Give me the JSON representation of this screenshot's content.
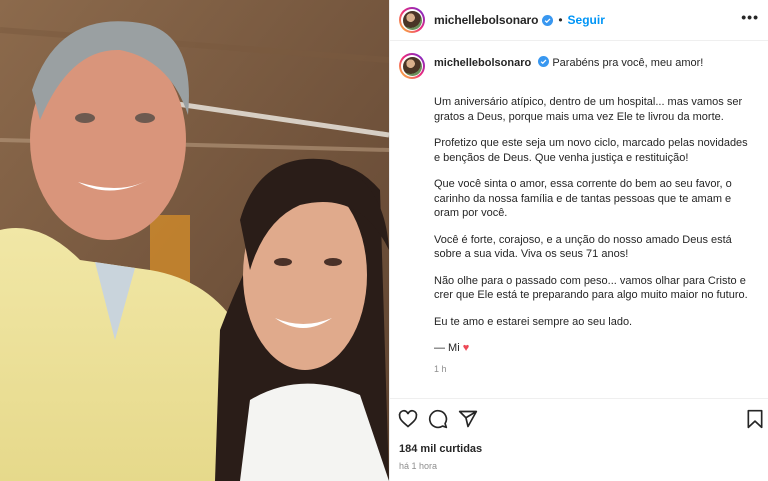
{
  "post": {
    "username": "michellebolsonaro",
    "follow_label": "Seguir",
    "separator": "•",
    "more_label": "•••",
    "caption_first": "Parabéns pra você, meu amor!",
    "paragraphs": [
      "Um aniversário atípico, dentro de um hospital... mas vamos ser gratos a Deus, porque mais uma vez Ele te livrou da morte.",
      "Profetizo que este seja um novo ciclo, marcado pelas novidades e bençãos de Deus. Que venha justiça e restituição!",
      "Que você sinta o amor, essa corrente do bem ao seu favor, o carinho da nossa família e de tantas pessoas que te amam e oram por você.",
      "Você é forte, corajoso, e a unção do nosso amado Deus está sobre a sua vida. Viva os seus 71 anos!",
      "Não olhe para o passado com peso... vamos olhar para Cristo e crer que Ele está te preparando para algo muito maior no futuro.",
      "Eu te amo e estarei sempre ao seu lado."
    ],
    "signature": "— Mi",
    "signature_heart": "♥",
    "caption_time": "1 h",
    "likes": "184 mil curtidas",
    "posted": "há 1 hora"
  },
  "icons": {
    "verified": "verified-badge-icon",
    "like": "heart-icon",
    "comment": "comment-icon",
    "share": "share-icon",
    "save": "bookmark-icon",
    "more": "more-options-icon"
  },
  "colors": {
    "link": "#0095f6",
    "verified": "#3897f0",
    "heart": "#ed4956",
    "muted": "#8e8e8e",
    "text": "#262626"
  }
}
